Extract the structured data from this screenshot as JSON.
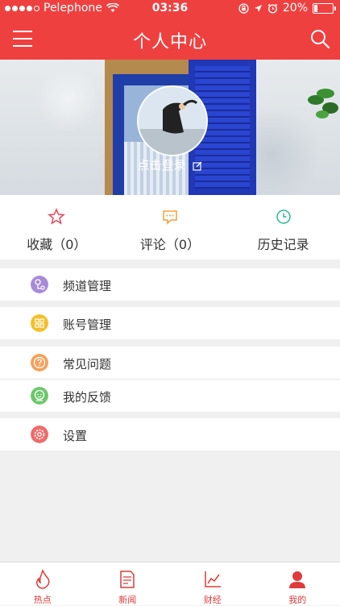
{
  "status": {
    "carrier": "Pelephone",
    "time": "03:36",
    "battery": "20%",
    "battery_level": 0.2
  },
  "nav": {
    "title": "个人中心",
    "menu_icon": "hamburger-icon",
    "search_icon": "search-icon"
  },
  "profile": {
    "login_text": "点击登录",
    "edit_icon": "edit-icon"
  },
  "stats": [
    {
      "label": "收藏（0）",
      "icon": "star-icon",
      "color": "#e8455a"
    },
    {
      "label": "评论（0）",
      "icon": "comment-icon",
      "color": "#f0a03c"
    },
    {
      "label": "历史记录",
      "icon": "clock-icon",
      "color": "#2bb68e"
    }
  ],
  "menu": {
    "channel": {
      "label": "频道管理",
      "color": "#a98ad9"
    },
    "account": {
      "label": "账号管理",
      "color": "#f2c02a"
    },
    "faq": {
      "label": "常见问题",
      "color": "#f5a05a"
    },
    "feedback": {
      "label": "我的反馈",
      "color": "#6cc86a"
    },
    "settings": {
      "label": "设置",
      "color": "#ef6b6b"
    }
  },
  "tabs": [
    {
      "label": "热点",
      "icon": "fire-icon"
    },
    {
      "label": "新闻",
      "icon": "newspaper-icon"
    },
    {
      "label": "财经",
      "icon": "chart-icon"
    },
    {
      "label": "我的",
      "icon": "person-icon",
      "active": true
    }
  ],
  "colors": {
    "brand": "#ef4040",
    "tab_active": "#e03a3a"
  }
}
